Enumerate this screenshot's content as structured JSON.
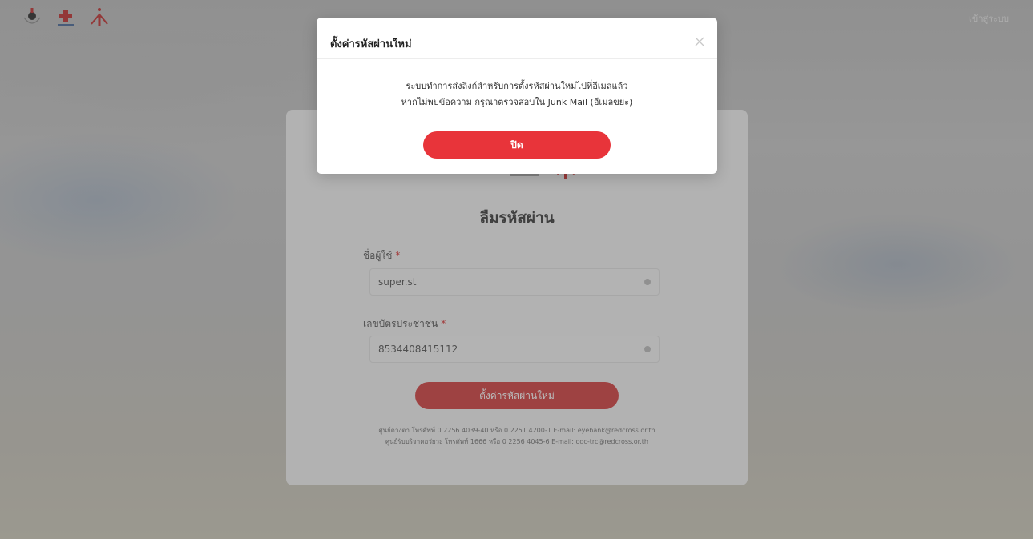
{
  "header": {
    "login_label": "เข้าสู่ระบบ"
  },
  "card": {
    "title": "ลืมรหัสผ่าน",
    "username": {
      "label": "ชื่อผู้ใช้",
      "required_mark": "*",
      "value": "super.st"
    },
    "citizen_id": {
      "label": "เลขบัตรประชาชน",
      "required_mark": "*",
      "value": "8534408415112"
    },
    "submit_label": "ตั้งค่ารหัสผ่านใหม่",
    "contact_line_1": "ศูนย์ดวงตา โทรศัพท์ 0 2256 4039-40 หรือ 0 2251 4200-1 E-mail: eyebank@redcross.or.th",
    "contact_line_2": "ศูนย์รับบริจาคอวัยวะ โทรศัพท์ 1666 หรือ 0 2256 4045-6 E-mail: odc-trc@redcross.or.th"
  },
  "modal": {
    "title": "ตั้งค่ารหัสผ่านใหม่",
    "message_line_1": "ระบบทำการส่งลิงก์สำหรับการตั้งรหัสผ่านใหม่ไปที่อีเมลแล้ว",
    "message_line_2": "หากไม่พบข้อความ กรุณาตรวจสอบใน Junk Mail (อีเมลขยะ)",
    "close_button_label": "ปิด"
  },
  "colors": {
    "brand_red": "#e8343a",
    "overlay": "#464646"
  }
}
